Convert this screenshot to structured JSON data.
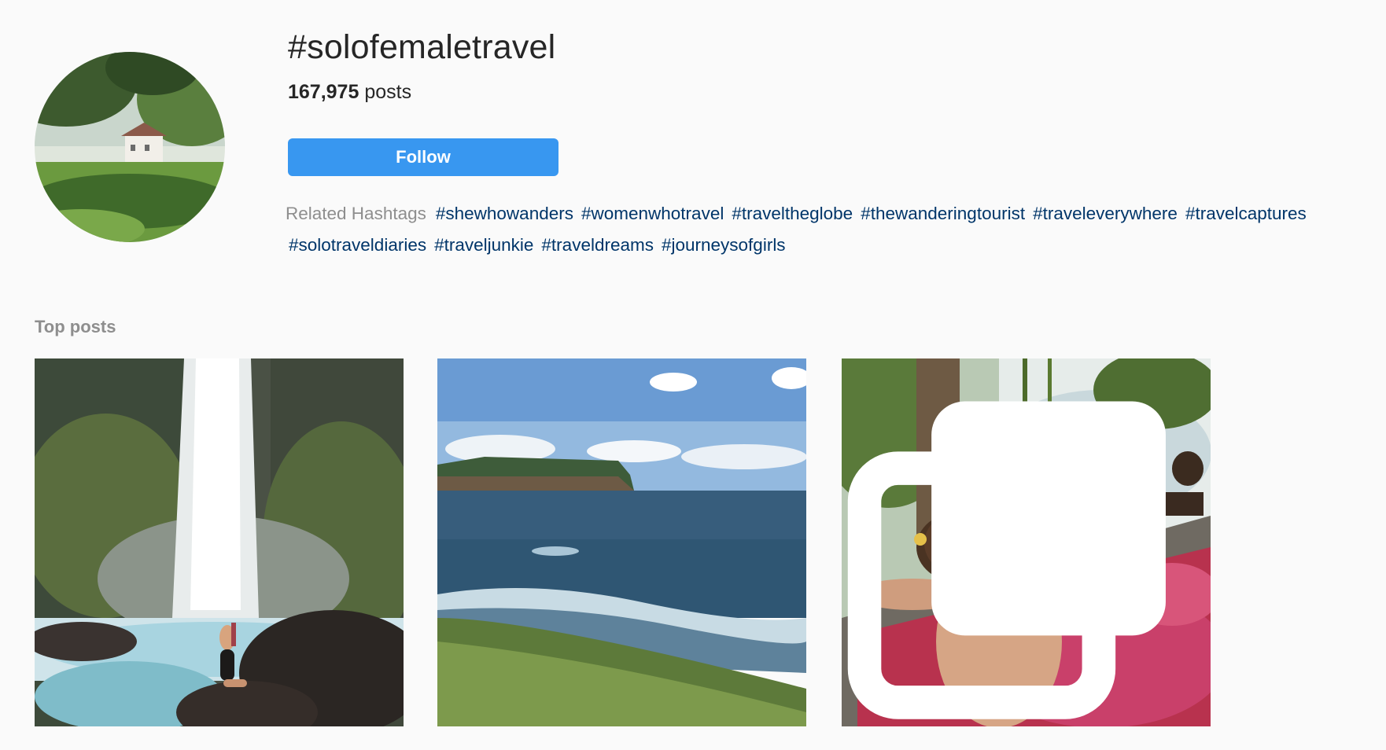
{
  "header": {
    "title": "#solofemaletravel",
    "post_count": "167,975",
    "post_count_suffix": " posts",
    "follow_label": "Follow"
  },
  "related": {
    "label": "Related Hashtags",
    "tags": [
      "#shewhowanders",
      "#womenwhotravel",
      "#traveltheglobe",
      "#thewanderingtourist",
      "#traveleverywhere",
      "#travelcaptures",
      "#solotraveldiaries",
      "#traveljunkie",
      "#traveldreams",
      "#journeysofgirls"
    ]
  },
  "top_posts": {
    "title": "Top posts",
    "posts": [
      {
        "icon": "none"
      },
      {
        "icon": "none"
      },
      {
        "icon": "multiple-photos-icon"
      }
    ]
  },
  "colors": {
    "background": "#fafafa",
    "accent": "#3897f0",
    "link": "#003569",
    "muted": "#8e8e8e",
    "text": "#262626"
  }
}
